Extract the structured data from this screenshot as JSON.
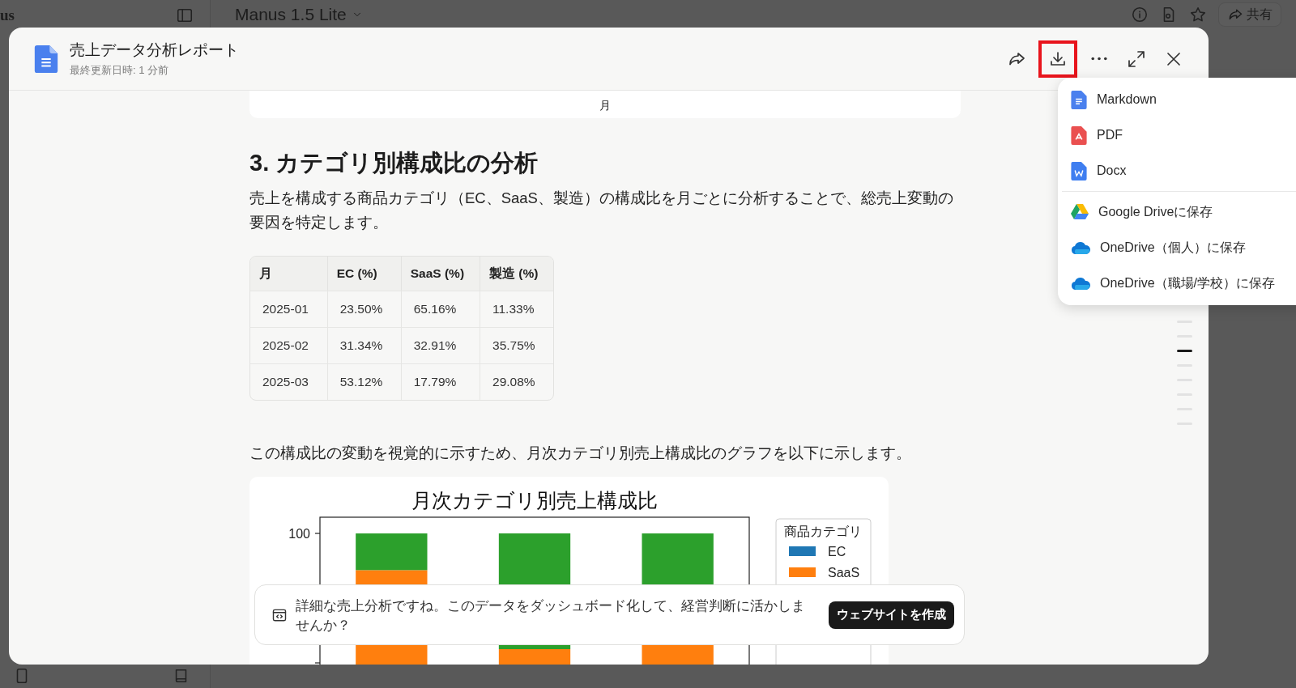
{
  "app": {
    "logo_fragment": "us",
    "model_name": "Manus 1.5 Lite",
    "share_label": "共有"
  },
  "document": {
    "title": "売上データ分析レポート",
    "updated": "最終更新日時: 1 分前",
    "download_highlighted": true,
    "previous_chart_fragment": "月",
    "heading": "3. カテゴリ別構成比の分析",
    "intro": "売上を構成する商品カテゴリ（EC、SaaS、製造）の構成比を月ごとに分析することで、総売上変動の要因を特定します。",
    "table": {
      "columns": [
        "月",
        "EC (%)",
        "SaaS (%)",
        "製造 (%)"
      ],
      "rows": [
        [
          "2025-01",
          "23.50%",
          "65.16%",
          "11.33%"
        ],
        [
          "2025-02",
          "31.34%",
          "32.91%",
          "35.75%"
        ],
        [
          "2025-03",
          "53.12%",
          "17.79%",
          "29.08%"
        ]
      ]
    },
    "chart_lead": "この構成比の変動を視覚的に示すため、月次カテゴリ別売上構成比のグラフを以下に示します。",
    "chart": {
      "kind": "picture",
      "title": "月次カテゴリ別売上構成比",
      "y_tick": "100",
      "legend_title": "商品カテゴリ",
      "legend": [
        {
          "label": "EC",
          "color": "#1f77b4"
        },
        {
          "label": "SaaS",
          "color": "#ff7f0e"
        }
      ]
    },
    "outline_marks": [
      {
        "selected": false
      },
      {
        "selected": false
      },
      {
        "selected": true
      },
      {
        "selected": false
      },
      {
        "selected": false
      },
      {
        "selected": false
      },
      {
        "selected": false
      },
      {
        "selected": false
      }
    ]
  },
  "download_menu": {
    "sections": [
      [
        {
          "kind": "markdown",
          "label": "Markdown"
        },
        {
          "kind": "pdf",
          "label": "PDF"
        },
        {
          "kind": "docx",
          "label": "Docx"
        }
      ],
      [
        {
          "kind": "gdrive",
          "label": "Google Driveに保存"
        },
        {
          "kind": "onedrive",
          "label": "OneDrive（個人）に保存"
        },
        {
          "kind": "onedrive",
          "label": "OneDrive（職場/学校）に保存"
        }
      ]
    ]
  },
  "suggestion": {
    "text": "詳細な売上分析ですね。このデータをダッシュボード化して、経営判断に活かしませんか？",
    "button": "ウェブサイトを作成"
  }
}
